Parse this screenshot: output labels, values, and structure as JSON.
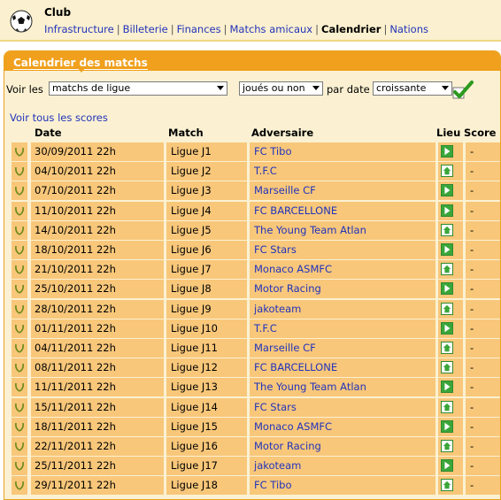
{
  "header": {
    "title": "Club",
    "nav": [
      {
        "label": "Infrastructure",
        "current": false
      },
      {
        "label": "Billeterie",
        "current": false
      },
      {
        "label": "Finances",
        "current": false
      },
      {
        "label": "Matchs amicaux",
        "current": false
      },
      {
        "label": "Calendrier",
        "current": true
      },
      {
        "label": "Nations",
        "current": false
      }
    ]
  },
  "panel": {
    "title": "Calendrier des matchs"
  },
  "filters": {
    "voir_label": "Voir les",
    "type_value": "matchs de ligue",
    "status_value": "joués ou non",
    "sort_label": "par date",
    "order_value": "croissante"
  },
  "voir_scores_link": "Voir tous les scores",
  "table": {
    "headers": {
      "date": "Date",
      "match": "Match",
      "adversaire": "Adversaire",
      "lieu": "Lieu",
      "score": "Score"
    },
    "rows": [
      {
        "date": "30/09/2011 22h",
        "match": "Ligue J1",
        "adversaire": "FC Tibo",
        "lieu": "away",
        "score": "-"
      },
      {
        "date": "04/10/2011 22h",
        "match": "Ligue J2",
        "adversaire": "T.F.C",
        "lieu": "home",
        "score": "-"
      },
      {
        "date": "07/10/2011 22h",
        "match": "Ligue J3",
        "adversaire": "Marseille CF",
        "lieu": "away",
        "score": "-"
      },
      {
        "date": "11/10/2011 22h",
        "match": "Ligue J4",
        "adversaire": "FC BARCELLONE",
        "lieu": "away",
        "score": "-"
      },
      {
        "date": "14/10/2011 22h",
        "match": "Ligue J5",
        "adversaire": "The Young Team Atlan",
        "lieu": "home",
        "score": "-"
      },
      {
        "date": "18/10/2011 22h",
        "match": "Ligue J6",
        "adversaire": "FC Stars",
        "lieu": "away",
        "score": "-"
      },
      {
        "date": "21/10/2011 22h",
        "match": "Ligue J7",
        "adversaire": "Monaco ASMFC",
        "lieu": "home",
        "score": "-"
      },
      {
        "date": "25/10/2011 22h",
        "match": "Ligue J8",
        "adversaire": "Motor Racing",
        "lieu": "away",
        "score": "-"
      },
      {
        "date": "28/10/2011 22h",
        "match": "Ligue J9",
        "adversaire": "jakoteam",
        "lieu": "home",
        "score": "-"
      },
      {
        "date": "01/11/2011 22h",
        "match": "Ligue J10",
        "adversaire": "T.F.C",
        "lieu": "away",
        "score": "-"
      },
      {
        "date": "04/11/2011 22h",
        "match": "Ligue J11",
        "adversaire": "Marseille CF",
        "lieu": "home",
        "score": "-"
      },
      {
        "date": "08/11/2011 22h",
        "match": "Ligue J12",
        "adversaire": "FC BARCELLONE",
        "lieu": "home",
        "score": "-"
      },
      {
        "date": "11/11/2011 22h",
        "match": "Ligue J13",
        "adversaire": "The Young Team Atlan",
        "lieu": "away",
        "score": "-"
      },
      {
        "date": "15/11/2011 22h",
        "match": "Ligue J14",
        "adversaire": "FC Stars",
        "lieu": "home",
        "score": "-"
      },
      {
        "date": "18/11/2011 22h",
        "match": "Ligue J15",
        "adversaire": "Monaco ASMFC",
        "lieu": "away",
        "score": "-"
      },
      {
        "date": "22/11/2011 22h",
        "match": "Ligue J16",
        "adversaire": "Motor Racing",
        "lieu": "home",
        "score": "-"
      },
      {
        "date": "25/11/2011 22h",
        "match": "Ligue J17",
        "adversaire": "jakoteam",
        "lieu": "away",
        "score": "-"
      },
      {
        "date": "29/11/2011 22h",
        "match": "Ligue J18",
        "adversaire": "FC Tibo",
        "lieu": "home",
        "score": "-"
      }
    ]
  },
  "colors": {
    "accent": "#f0a01d",
    "row_bg": "#f8c77a",
    "link": "#2233bb",
    "lieu_green": "#2f8a2f"
  },
  "icons": {
    "club": "soccer-ball-icon",
    "ok": "checkmark-icon",
    "row": "laurel-icon",
    "away": "arrow-right-icon",
    "home": "house-icon"
  }
}
